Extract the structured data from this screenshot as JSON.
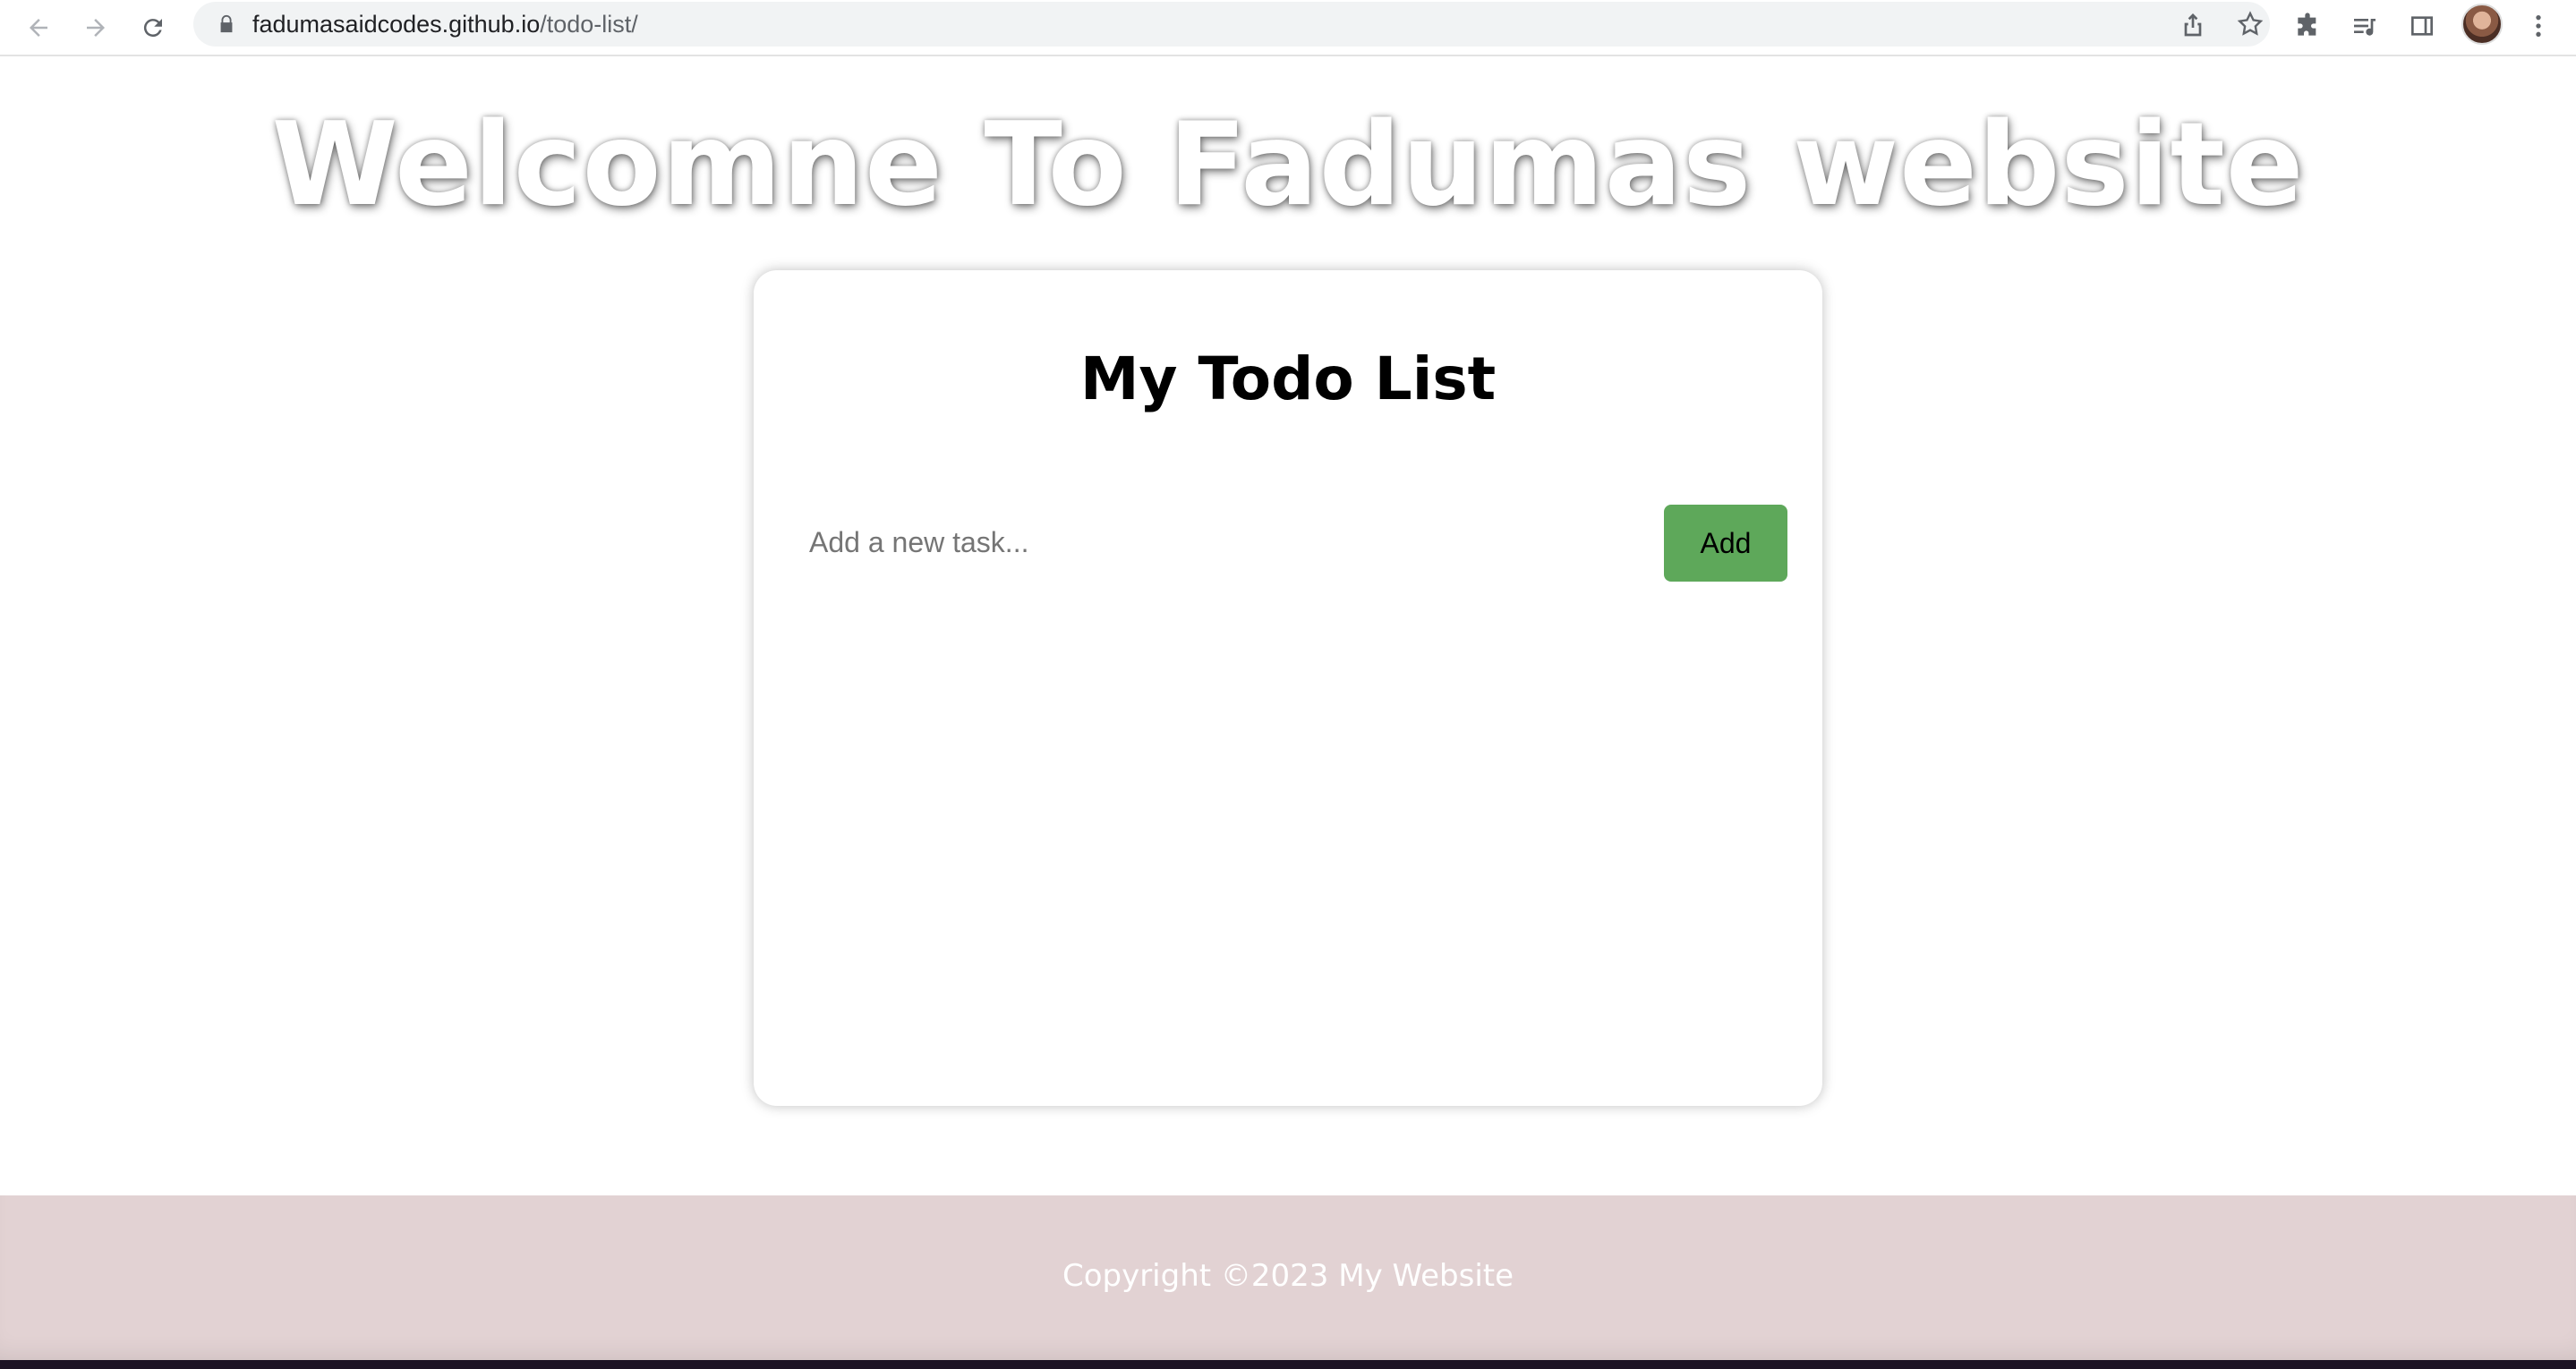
{
  "browser": {
    "url_host": "fadumasaidcodes.github.io",
    "url_path": "/todo-list/",
    "icons": [
      "back-arrow-icon",
      "forward-arrow-icon",
      "reload-icon",
      "lock-icon",
      "share-icon",
      "star-icon",
      "extensions-icon",
      "reading-list-icon",
      "side-panel-icon",
      "profile-avatar",
      "more-vert-icon"
    ]
  },
  "page": {
    "welcome_heading": "Welcomne To Fadumas website",
    "card": {
      "title": "My Todo List",
      "input_placeholder": "Add a new task...",
      "input_value": "",
      "add_button_label": "Add"
    },
    "footer": {
      "copyright": "Copyright ©2023 My Website"
    }
  },
  "colors": {
    "add_button": "#5ea85a",
    "footer_bg": "#e2d2d3",
    "page_bg": "#ffffff"
  }
}
